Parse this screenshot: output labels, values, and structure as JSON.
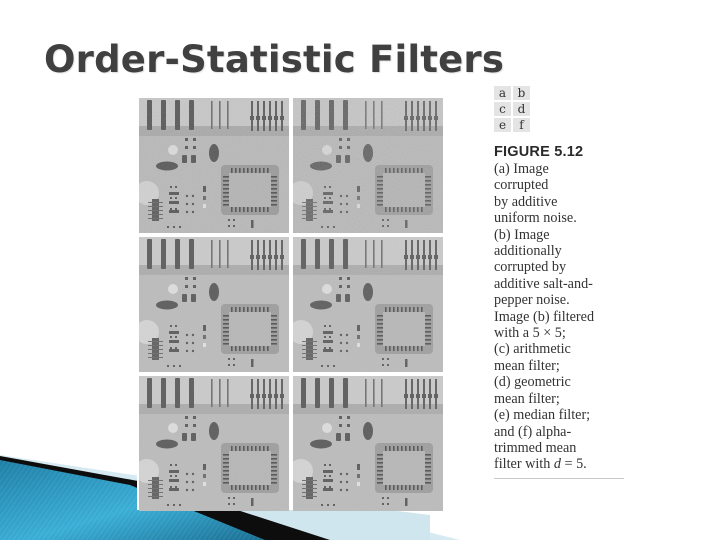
{
  "slide": {
    "title": "Order-Statistic Filters"
  },
  "figure": {
    "panels": [
      {
        "label": "a",
        "noise": "uniform"
      },
      {
        "label": "b",
        "noise": "uniform + salt-and-pepper"
      },
      {
        "label": "c",
        "filter": "arithmetic mean"
      },
      {
        "label": "d",
        "filter": "geometric mean"
      },
      {
        "label": "e",
        "filter": "median"
      },
      {
        "label": "f",
        "filter": "alpha-trimmed mean"
      }
    ],
    "label_grid": [
      "a",
      "b",
      "c",
      "d",
      "e",
      "f"
    ],
    "number": "FIGURE 5.12",
    "caption_lines": [
      "(a) Image",
      "corrupted",
      "by additive",
      "uniform noise.",
      "(b) Image",
      "additionally",
      "corrupted by",
      "additive salt-and-",
      "pepper noise.",
      "Image (b) filtered",
      "with a 5 × 5;",
      "(c) arithmetic",
      "mean filter;",
      "(d) geometric",
      "mean filter;",
      "(e) median filter;",
      "and (f) alpha-",
      "trimmed mean",
      "filter with d = 5."
    ]
  },
  "theme": {
    "title_color": "#404040",
    "swoosh_blue": "#2a9cc4",
    "swoosh_dark": "#0d0d0d",
    "swoosh_light": "#cfe6ee"
  }
}
